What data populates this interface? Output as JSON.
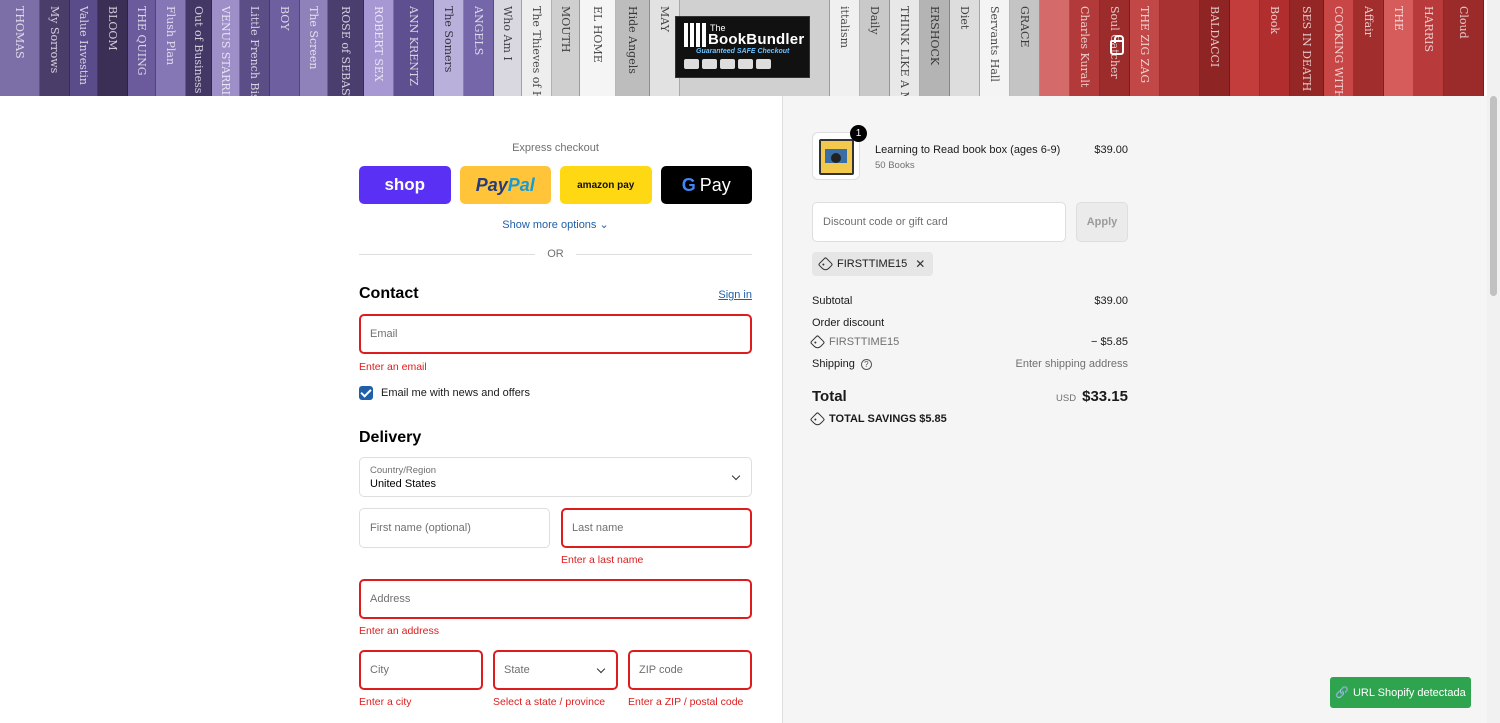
{
  "banner": {
    "spines": [
      {
        "color": "#7c6fa8",
        "w": 40,
        "t": "THOMAS"
      },
      {
        "color": "#4b3d6a",
        "w": 30,
        "t": "My Sorrows"
      },
      {
        "color": "#5a4c8a",
        "w": 28,
        "t": "Value Investin"
      },
      {
        "color": "#3b2f55",
        "w": 30,
        "t": "BLOOM"
      },
      {
        "color": "#6b5b9c",
        "w": 28,
        "t": "THE QUING"
      },
      {
        "color": "#8576b5",
        "w": 30,
        "t": "Flush Plan"
      },
      {
        "color": "#433766",
        "w": 26,
        "t": "Out of Business"
      },
      {
        "color": "#9e8fc9",
        "w": 28,
        "t": "VENUS STARRING ONE"
      },
      {
        "color": "#5b4e86",
        "w": 30,
        "t": "Little French Bistro"
      },
      {
        "color": "#6e5fa0",
        "w": 30,
        "t": "BOY"
      },
      {
        "color": "#8f82bb",
        "w": 28,
        "t": "The Screen"
      },
      {
        "color": "#4a3e6e",
        "w": 36,
        "t": "ROSE of SEBASTOPOL"
      },
      {
        "color": "#a798d3",
        "w": 30,
        "t": "ROBERT SEX"
      },
      {
        "color": "#5e5090",
        "w": 40,
        "t": "ANN KRENTZ"
      },
      {
        "color": "#b9b0db",
        "w": 30,
        "t": "The Somers"
      },
      {
        "color": "#7566a9",
        "w": 30,
        "t": "ANGELS"
      },
      {
        "color": "#d9d7e0",
        "w": 28,
        "t": "Who Am I"
      },
      {
        "color": "#eeeeee",
        "w": 30,
        "t": "The Thieves of Heaven"
      },
      {
        "color": "#cfcfcf",
        "w": 28,
        "t": "MOUTH"
      },
      {
        "color": "#f5f5f5",
        "w": 36,
        "t": "EL HOME"
      },
      {
        "color": "#bdbdbd",
        "w": 34,
        "t": "Hide Angels"
      },
      {
        "color": "#e2e2e2",
        "w": 30,
        "t": "MAY"
      },
      {
        "color": "#d0d0d0",
        "w": 150,
        "t": ""
      },
      {
        "color": "#f0f0f0",
        "w": 30,
        "t": "ittalism"
      },
      {
        "color": "#c9c9c9",
        "w": 30,
        "t": "Daily"
      },
      {
        "color": "#e8e8e8",
        "w": 30,
        "t": "THINK LIKE A MAN"
      },
      {
        "color": "#b4b4b4",
        "w": 30,
        "t": "ERSHOCK"
      },
      {
        "color": "#dddddd",
        "w": 30,
        "t": "Diet"
      },
      {
        "color": "#f4f4f4",
        "w": 30,
        "t": "Servants Hall"
      },
      {
        "color": "#c4c4c4",
        "w": 30,
        "t": "GRACE"
      },
      {
        "color": "#d46a6a",
        "w": 30,
        "t": ""
      },
      {
        "color": "#b33a3a",
        "w": 30,
        "t": "Charles Kuralt"
      },
      {
        "color": "#9c2b2b",
        "w": 30,
        "t": "Soul Catcher"
      },
      {
        "color": "#c24848",
        "w": 30,
        "t": "THE ZIG ZAG"
      },
      {
        "color": "#a83232",
        "w": 40,
        "t": ""
      },
      {
        "color": "#8e2424",
        "w": 30,
        "t": "BALDACCI"
      },
      {
        "color": "#c33d3d",
        "w": 30,
        "t": ""
      },
      {
        "color": "#b02e2e",
        "w": 30,
        "t": "Book"
      },
      {
        "color": "#942626",
        "w": 34,
        "t": "SES IN DEATH"
      },
      {
        "color": "#c94646",
        "w": 30,
        "t": "COOKING WITH LOVE"
      },
      {
        "color": "#a22d2d",
        "w": 30,
        "t": "Affair"
      },
      {
        "color": "#d65c5c",
        "w": 30,
        "t": "THE"
      },
      {
        "color": "#b83a3a",
        "w": 30,
        "t": "HARRIS"
      },
      {
        "color": "#9b2a2a",
        "w": 40,
        "t": "Cloud"
      }
    ]
  },
  "logo": {
    "small": "The",
    "name": "BookBundler",
    "tag": "Guaranteed SAFE Checkout"
  },
  "express": {
    "title": "Express checkout",
    "shop": "shop",
    "paypal_a": "Pay",
    "paypal_b": "Pal",
    "amazon": "amazon pay",
    "gpay_g": "G",
    "gpay": "Pay",
    "more": "Show more options",
    "or": "OR"
  },
  "contact": {
    "title": "Contact",
    "signin": "Sign in",
    "email_placeholder": "Email",
    "email_error": "Enter an email",
    "newsletter": "Email me with news and offers"
  },
  "delivery": {
    "title": "Delivery",
    "country_label": "Country/Region",
    "country_value": "United States",
    "first_name": "First name (optional)",
    "last_name": "Last name",
    "last_name_error": "Enter a last name",
    "address": "Address",
    "address_error": "Enter an address",
    "city": "City",
    "city_error": "Enter a city",
    "state": "State",
    "state_error": "Select a state / province",
    "zip": "ZIP code",
    "zip_error": "Enter a ZIP / postal code"
  },
  "summary": {
    "item": {
      "qty": "1",
      "name": "Learning to Read book box (ages 6-9)",
      "variant": "50 Books",
      "price": "$39.00"
    },
    "discount_placeholder": "Discount code or gift card",
    "apply": "Apply",
    "applied_code": "FIRSTTIME15",
    "subtotal_label": "Subtotal",
    "subtotal": "$39.00",
    "order_discount": "Order discount",
    "discount_code": "FIRSTTIME15",
    "discount_amount": "− $5.85",
    "shipping_label": "Shipping",
    "shipping_value": "Enter shipping address",
    "total_label": "Total",
    "currency": "USD",
    "total": "$33.15",
    "savings": "TOTAL SAVINGS  $5.85"
  },
  "extension": {
    "label": "URL Shopify detectada"
  },
  "colors": {
    "error": "#dd1d1d",
    "link": "#1f5fa8",
    "shop": "#5a31f4",
    "paypal": "#ffc439",
    "amazon": "#ffd814",
    "extension": "#2ea44f"
  }
}
